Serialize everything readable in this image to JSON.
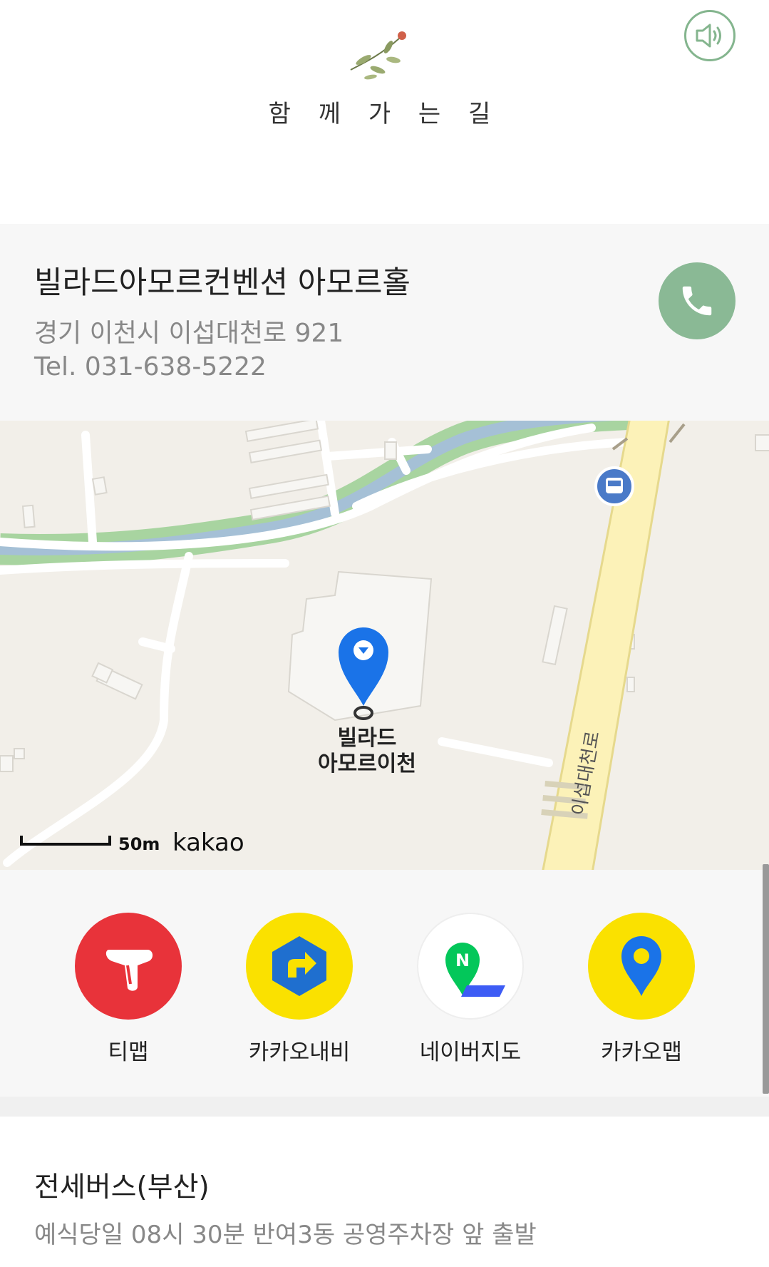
{
  "header": {
    "title": "함 께 가 는 길",
    "sound_icon": "speaker-icon",
    "decoration_icon": "flower-sprig-icon"
  },
  "venue": {
    "name": "빌라드아모르컨벤션 아모르홀",
    "address": "경기 이천시 이섭대천로 921",
    "tel": "Tel. 031-638-5222",
    "call_icon": "phone-icon"
  },
  "map": {
    "place_label_line1": "빌라드",
    "place_label_line2": "아모르이천",
    "road_label": "이섭대천로",
    "scale": "50m",
    "provider": "kakao"
  },
  "apps": [
    {
      "label": "티맵",
      "icon": "tmap-icon"
    },
    {
      "label": "카카오내비",
      "icon": "kakaonavi-icon"
    },
    {
      "label": "네이버지도",
      "icon": "navermap-icon"
    },
    {
      "label": "카카오맵",
      "icon": "kakaomap-icon"
    }
  ],
  "transport": {
    "title": "전세버스(부산)",
    "description": "예식당일 08시 30분 반여3동 공영주차장 앞 출발"
  },
  "colors": {
    "accent_green": "#8ab995",
    "tmap_red": "#e8333a",
    "kakao_yellow": "#fae100",
    "kakao_blue": "#1a73e8",
    "naver_green": "#03c75a"
  }
}
